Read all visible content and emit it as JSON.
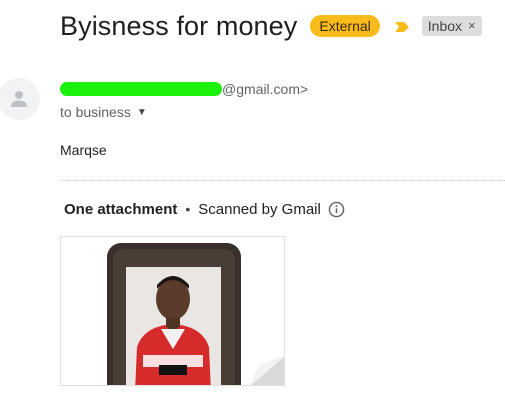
{
  "email": {
    "subject": "Byisness for money",
    "badge_external": "External",
    "label_inbox": "Inbox",
    "label_remove": "×",
    "sender_suffix": "@gmail.com>",
    "to_line": "to business",
    "body": "Marqse"
  },
  "attachments": {
    "count_label": "One attachment",
    "separator": "•",
    "scanned_label": "Scanned by Gmail"
  },
  "colors": {
    "external_badge": "#f7bc1b",
    "importance_marker": "#f7bc1b",
    "redaction": "#1cf00d",
    "inbox_label": "#dddddd"
  },
  "icons": {
    "avatar": "person-icon",
    "importance": "importance-marker-icon",
    "dropdown": "caret-down-icon",
    "info": "info-icon"
  }
}
